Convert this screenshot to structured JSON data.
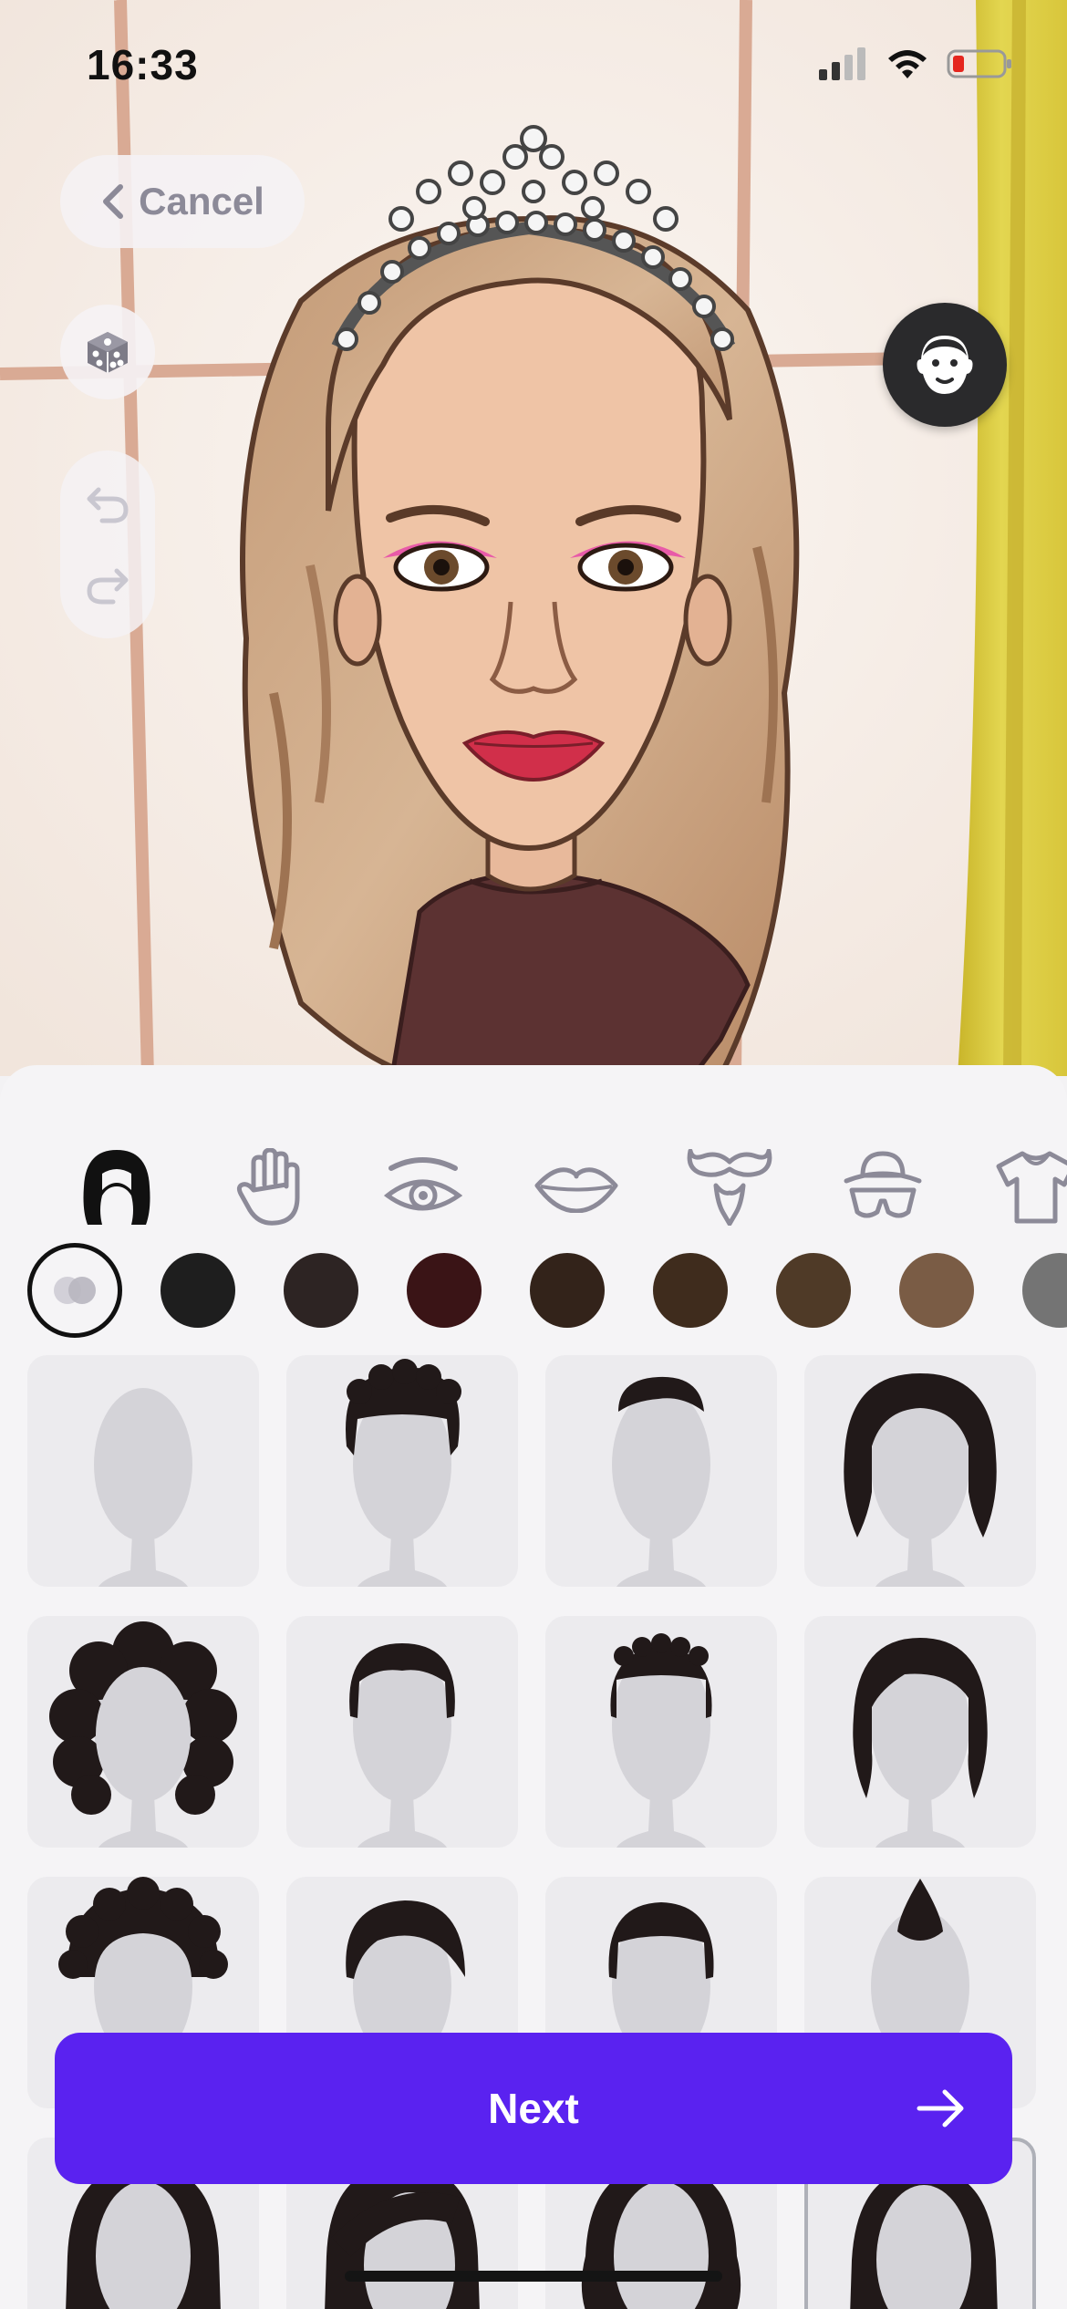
{
  "status_bar": {
    "time": "16:33",
    "icons": [
      "signal-icon",
      "wifi-icon",
      "battery-low-icon"
    ]
  },
  "toolbar": {
    "cancel_label": "Cancel",
    "buttons": [
      "randomize-dice-icon",
      "undo-icon",
      "redo-icon",
      "face-preview-icon"
    ]
  },
  "categories": [
    {
      "icon": "hair-icon",
      "selected": true
    },
    {
      "icon": "hand-icon",
      "selected": false
    },
    {
      "icon": "eye-icon",
      "selected": false
    },
    {
      "icon": "lips-icon",
      "selected": false
    },
    {
      "icon": "mustache-icon",
      "selected": false
    },
    {
      "icon": "hat-glasses-icon",
      "selected": false
    },
    {
      "icon": "tshirt-icon",
      "selected": false
    }
  ],
  "hair_colors": [
    {
      "name": "color-mix",
      "hex": "#f5f4f6",
      "selected": true
    },
    {
      "name": "black",
      "hex": "#1e1e1e",
      "selected": false
    },
    {
      "name": "dark-brown",
      "hex": "#2d2423",
      "selected": false
    },
    {
      "name": "burgundy",
      "hex": "#3a1416",
      "selected": false
    },
    {
      "name": "espresso",
      "hex": "#33231a",
      "selected": false
    },
    {
      "name": "chocolate",
      "hex": "#3f2c1d",
      "selected": false
    },
    {
      "name": "brown",
      "hex": "#4f3a27",
      "selected": false
    },
    {
      "name": "light-brown",
      "hex": "#7a5c45",
      "selected": false
    },
    {
      "name": "gray",
      "hex": "#747474",
      "selected": false
    }
  ],
  "hair_styles": [
    {
      "style": "bald"
    },
    {
      "style": "short-curly-top"
    },
    {
      "style": "short-slick"
    },
    {
      "style": "wavy-bob"
    },
    {
      "style": "big-curly"
    },
    {
      "style": "short-classic"
    },
    {
      "style": "short-textured"
    },
    {
      "style": "bob-side-part"
    },
    {
      "style": "afro"
    },
    {
      "style": "side-swept"
    },
    {
      "style": "crew-cut"
    },
    {
      "style": "top-knot"
    },
    {
      "style": "long-straight"
    },
    {
      "style": "long-side-part"
    },
    {
      "style": "long-wavy"
    },
    {
      "style": "long-center-part",
      "selected": true
    }
  ],
  "primary_action": {
    "label": "Next",
    "color": "#5a22f0"
  }
}
